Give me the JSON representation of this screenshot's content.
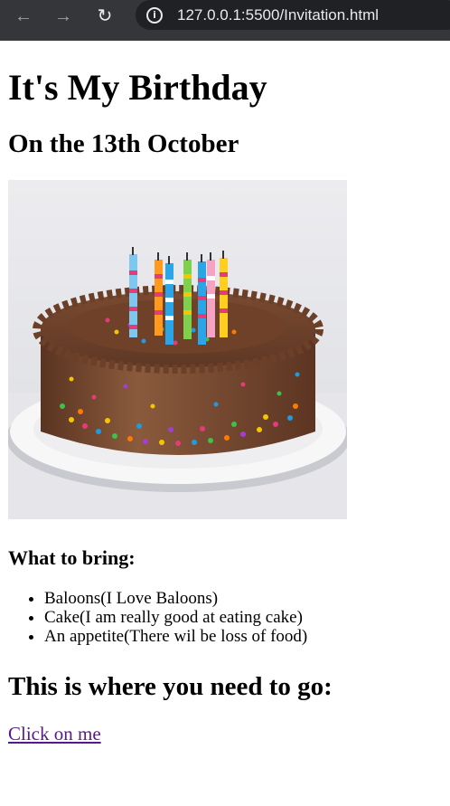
{
  "browser": {
    "back_icon": "←",
    "forward_icon": "→",
    "reload_icon": "↻",
    "info_icon": "i",
    "url": "127.0.0.1:5500/Invitation.html"
  },
  "page": {
    "title": "It's My Birthday",
    "date_heading": "On the 13th October",
    "bring_heading": "What to bring:",
    "bring_items": [
      "Baloons(I Love Baloons)",
      "Cake(I am really good at eating cake)",
      "An appetite(There wil be loss of food)"
    ],
    "destination_heading": "This is where you need to go:",
    "link_text": "Click on me"
  }
}
